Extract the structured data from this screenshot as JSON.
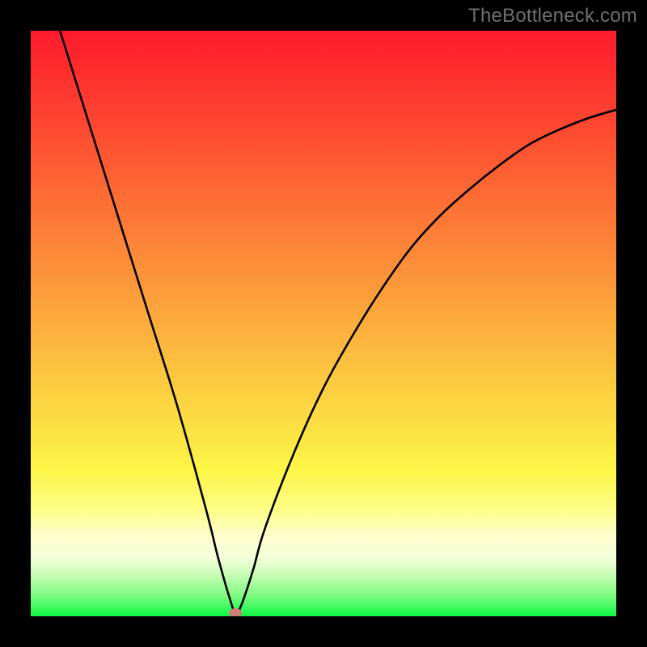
{
  "watermark": "TheBottleneck.com",
  "chart_data": {
    "type": "line",
    "title": "",
    "xlabel": "",
    "ylabel": "",
    "xlim": [
      0,
      100
    ],
    "ylim": [
      0,
      100
    ],
    "grid": false,
    "legend": false,
    "series": [
      {
        "name": "bottleneck-curve",
        "x": [
          5,
          10,
          15,
          20,
          25,
          30,
          32,
          34,
          35,
          36,
          38,
          40,
          45,
          50,
          55,
          60,
          65,
          70,
          75,
          80,
          85,
          90,
          95,
          100
        ],
        "values": [
          100,
          84,
          68,
          52,
          36,
          18,
          10,
          3,
          0.5,
          2,
          8,
          15,
          28,
          39,
          48,
          56,
          63,
          68.5,
          73,
          77,
          80.5,
          83,
          85,
          86.5
        ]
      }
    ],
    "marker": {
      "x": 35,
      "y": 0.5,
      "color": "#cf7d79"
    },
    "background_gradient": {
      "stops": [
        {
          "offset": 0.0,
          "color": "#fe1b2c"
        },
        {
          "offset": 0.15,
          "color": "#fe4430"
        },
        {
          "offset": 0.3,
          "color": "#fd7135"
        },
        {
          "offset": 0.45,
          "color": "#fc9d3b"
        },
        {
          "offset": 0.6,
          "color": "#fcca40"
        },
        {
          "offset": 0.75,
          "color": "#fcf546"
        },
        {
          "offset": 0.82,
          "color": "#fdfe8a"
        },
        {
          "offset": 0.86,
          "color": "#fefecb"
        },
        {
          "offset": 0.9,
          "color": "#f4feda"
        },
        {
          "offset": 0.93,
          "color": "#c6fdb4"
        },
        {
          "offset": 0.96,
          "color": "#88fc88"
        },
        {
          "offset": 0.985,
          "color": "#3ffa5f"
        },
        {
          "offset": 1.0,
          "color": "#0df940"
        }
      ]
    }
  }
}
